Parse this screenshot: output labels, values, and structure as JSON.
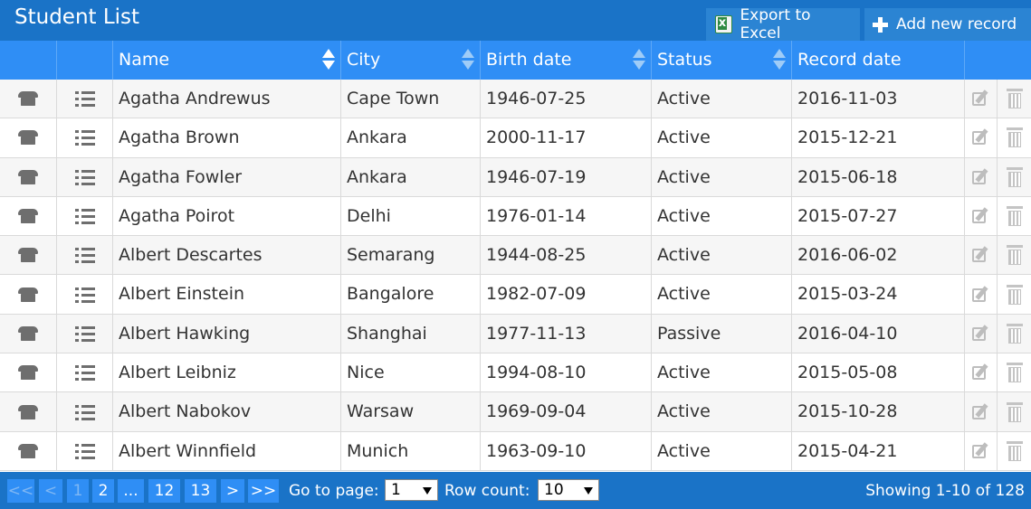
{
  "app": {
    "title": "Student List"
  },
  "toolbar": {
    "export_label": "Export to Excel",
    "add_label": "Add new record"
  },
  "columns": [
    {
      "label": "Name",
      "sort": "asc"
    },
    {
      "label": "City",
      "sort": "none"
    },
    {
      "label": "Birth date",
      "sort": "none"
    },
    {
      "label": "Status",
      "sort": "none"
    },
    {
      "label": "Record date",
      "sort": "none"
    }
  ],
  "rows": [
    {
      "name": "Agatha Andrewus",
      "city": "Cape Town",
      "birth": "1946-07-25",
      "status": "Active",
      "record": "2016-11-03"
    },
    {
      "name": "Agatha Brown",
      "city": "Ankara",
      "birth": "2000-11-17",
      "status": "Active",
      "record": "2015-12-21"
    },
    {
      "name": "Agatha Fowler",
      "city": "Ankara",
      "birth": "1946-07-19",
      "status": "Active",
      "record": "2015-06-18"
    },
    {
      "name": "Agatha Poirot",
      "city": "Delhi",
      "birth": "1976-01-14",
      "status": "Active",
      "record": "2015-07-27"
    },
    {
      "name": "Albert Descartes",
      "city": "Semarang",
      "birth": "1944-08-25",
      "status": "Active",
      "record": "2016-06-02"
    },
    {
      "name": "Albert Einstein",
      "city": "Bangalore",
      "birth": "1982-07-09",
      "status": "Active",
      "record": "2015-03-24"
    },
    {
      "name": "Albert Hawking",
      "city": "Shanghai",
      "birth": "1977-11-13",
      "status": "Passive",
      "record": "2016-04-10"
    },
    {
      "name": "Albert Leibniz",
      "city": "Nice",
      "birth": "1994-08-10",
      "status": "Active",
      "record": "2015-05-08"
    },
    {
      "name": "Albert Nabokov",
      "city": "Warsaw",
      "birth": "1969-09-04",
      "status": "Active",
      "record": "2015-10-28"
    },
    {
      "name": "Albert Winnfield",
      "city": "Munich",
      "birth": "1963-09-10",
      "status": "Active",
      "record": "2015-04-21"
    }
  ],
  "pager": {
    "first": "<<",
    "prev": "<",
    "current": "1",
    "p2": "2",
    "ellipsis": "...",
    "p12": "12",
    "p13": "13",
    "next": ">",
    "last": ">>",
    "goto_label": "Go to page:",
    "goto_value": "1",
    "rowcount_label": "Row count:",
    "rowcount_value": "10",
    "showing": "Showing 1-10 of 128"
  },
  "icons": {
    "phone": "phone-icon",
    "list": "list-icon",
    "edit": "edit-icon",
    "delete": "trash-icon",
    "excel": "excel-icon",
    "add": "plus-icon"
  },
  "colors": {
    "titlebar": "#1a73c7",
    "header": "#2f8ef5",
    "button": "#2b84d3"
  }
}
